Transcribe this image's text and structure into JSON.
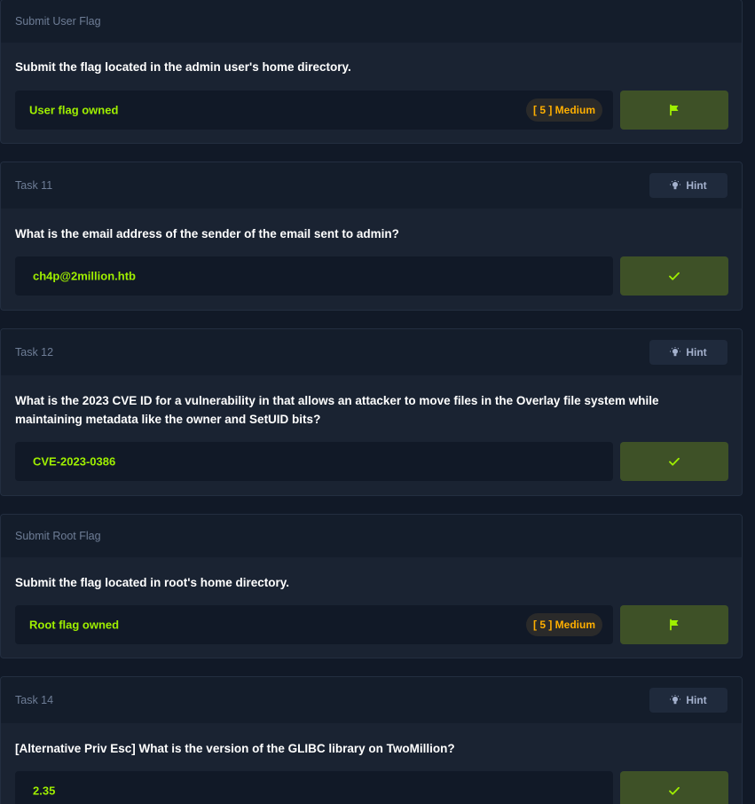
{
  "hint_label": "Hint",
  "icons": {
    "hint": "lightbulb-icon",
    "check": "check-icon",
    "flag": "flag-icon"
  },
  "colors": {
    "accent_green": "#9fef00",
    "medium_orange": "#ffaf00",
    "button_green": "#3e5127"
  },
  "cards": [
    {
      "title": "Submit User Flag",
      "question": "Submit the flag located in the admin user's home directory.",
      "answer": "User flag owned",
      "badge": "[ 5 ] Medium"
    },
    {
      "title": "Task 11",
      "question": "What is the email address of the sender of the email sent to admin?",
      "answer": "ch4p@2million.htb"
    },
    {
      "title": "Task 12",
      "question": "What is the 2023 CVE ID for a vulnerability in that allows an attacker to move files in the Overlay file system while maintaining metadata like the owner and SetUID bits?",
      "answer": "CVE-2023-0386"
    },
    {
      "title": "Submit Root Flag",
      "question": "Submit the flag located in root's home directory.",
      "answer": "Root flag owned",
      "badge": "[ 5 ] Medium"
    },
    {
      "title": "Task 14",
      "question": "[Alternative Priv Esc] What is the version of the GLIBC library on TwoMillion?",
      "answer": "2.35"
    }
  ]
}
